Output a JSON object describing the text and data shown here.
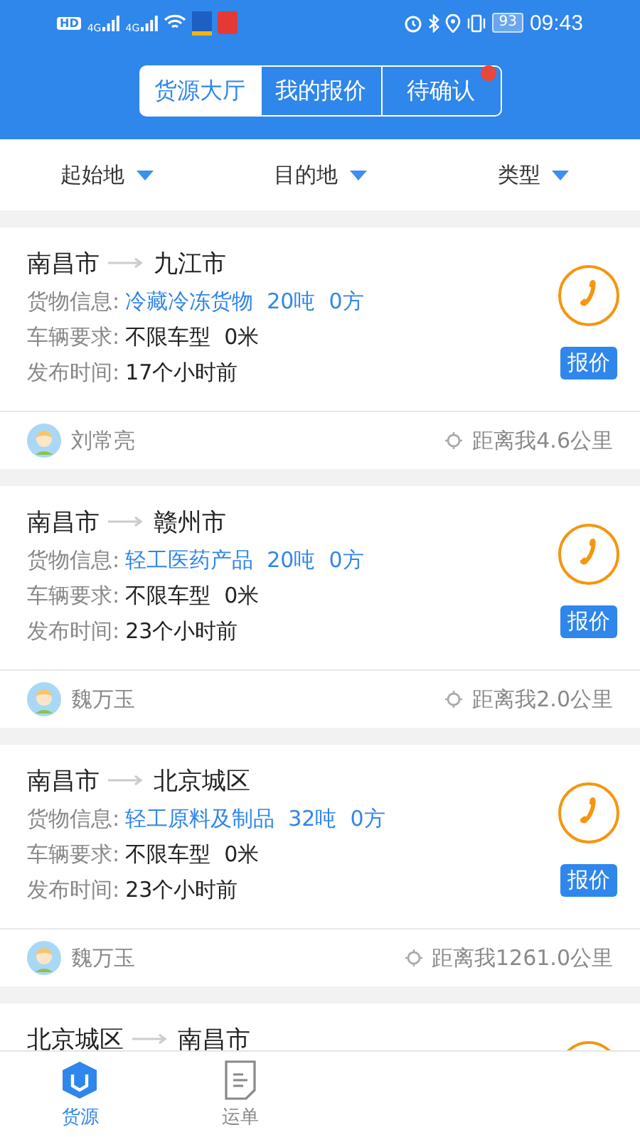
{
  "status_bar": {
    "hd_label": "HD",
    "network_labels": [
      "4G",
      "4G"
    ],
    "battery": "93",
    "time": "09:43"
  },
  "segments": [
    {
      "label": "货源大厅",
      "selected": true,
      "badge": false
    },
    {
      "label": "我的报价",
      "selected": false,
      "badge": false
    },
    {
      "label": "待确认",
      "selected": false,
      "badge": true
    }
  ],
  "filters": [
    "起始地",
    "目的地",
    "类型"
  ],
  "listings": [
    {
      "from": "南昌市",
      "to": "九江市",
      "cargo_label": "货物信息:",
      "cargo": "冷藏冷冻货物  20吨  0方",
      "vehicle_label": "车辆要求:",
      "vehicle": "不限车型  0米",
      "time_label": "发布时间:",
      "time": "17个小时前",
      "quote": "报价",
      "shipper": "刘常亮",
      "distance": "距离我4.6公里"
    },
    {
      "from": "南昌市",
      "to": "赣州市",
      "cargo_label": "货物信息:",
      "cargo": "轻工医药产品  20吨  0方",
      "vehicle_label": "车辆要求:",
      "vehicle": "不限车型  0米",
      "time_label": "发布时间:",
      "time": "23个小时前",
      "quote": "报价",
      "shipper": "魏万玉",
      "distance": "距离我2.0公里"
    },
    {
      "from": "南昌市",
      "to": "北京城区",
      "cargo_label": "货物信息:",
      "cargo": "轻工原料及制品  32吨  0方",
      "vehicle_label": "车辆要求:",
      "vehicle": "不限车型  0米",
      "time_label": "发布时间:",
      "time": "23个小时前",
      "quote": "报价",
      "shipper": "魏万玉",
      "distance": "距离我1261.0公里"
    },
    {
      "from": "北京城区",
      "to": "南昌市"
    }
  ],
  "bottom_nav": [
    {
      "label": "货源",
      "selected": true,
      "kind": "box"
    },
    {
      "label": "运单",
      "selected": false,
      "kind": "list"
    }
  ]
}
